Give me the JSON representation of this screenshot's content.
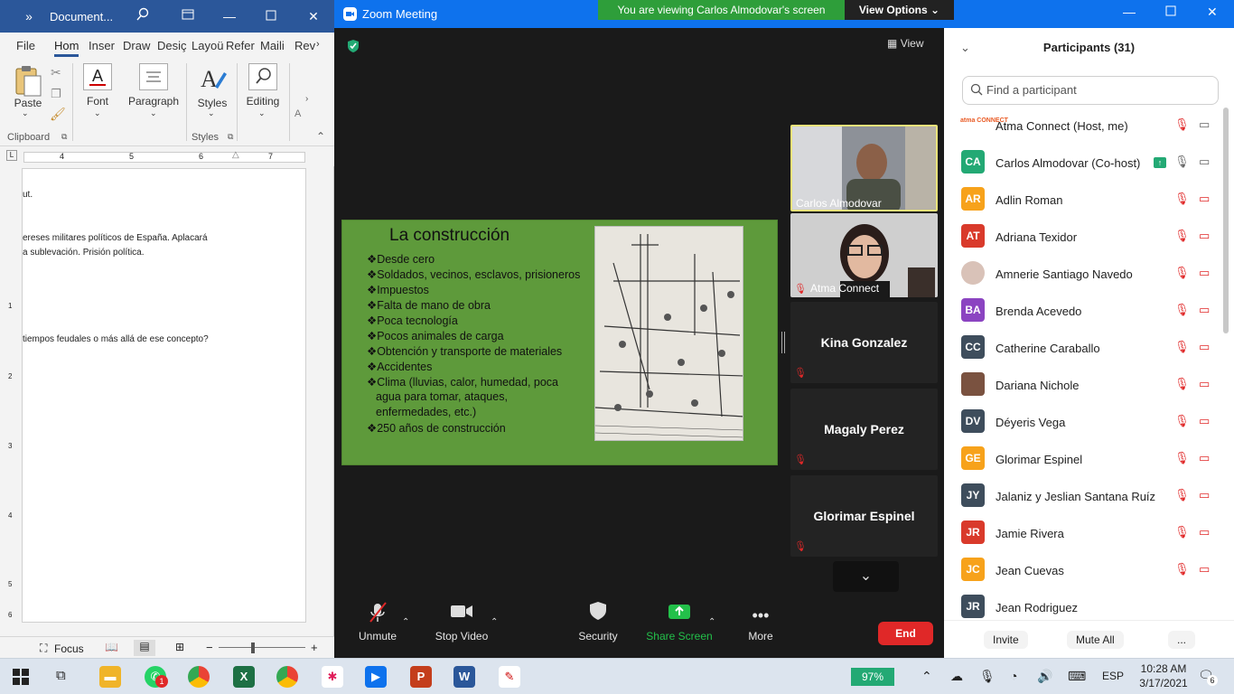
{
  "word": {
    "title": "Document...",
    "tabs": [
      "File",
      "Hom",
      "Inser",
      "Draw",
      "Desiç",
      "Layoü",
      "Refer",
      "Maili",
      "Rev"
    ],
    "ribbon": {
      "paste": "Paste",
      "font": "Font",
      "paragraph": "Paragraph",
      "styles": "Styles",
      "editing": "Editing",
      "clipboard_group": "Clipboard",
      "styles_group": "Styles"
    },
    "ruler_numbers": [
      "4",
      "5",
      "6",
      "7"
    ],
    "doc_lines": [
      "ut.",
      "ereses militares políticos de España. Aplacará",
      "a sublevación. Prisión política.",
      "tiempos feudales o más allá de ese concepto?"
    ],
    "vruler_numbers": [
      "1",
      "2",
      "3",
      "4",
      "5",
      "6"
    ],
    "status": {
      "focus": "Focus"
    }
  },
  "zoom": {
    "title": "Zoom Meeting",
    "banner": "You are viewing Carlos Almodovar's screen",
    "view_options": "View Options",
    "view_button": "View",
    "slide": {
      "title": "La construcción",
      "bullets": [
        "❖Desde cero",
        "❖Soldados, vecinos, esclavos, prisioneros",
        "❖Impuestos",
        "❖Falta de mano de obra",
        "❖Poca tecnología",
        "❖Pocos animales de carga",
        "❖Obtención y transporte de materiales",
        "❖Accidentes",
        "❖Clima (lluvias, calor, humedad, poca",
        "agua para tomar, ataques,",
        "enfermedades, etc.)",
        "❖250 años de construcción"
      ]
    },
    "tiles": [
      "Carlos Almodovar",
      "Atma Connect",
      "Kina Gonzalez",
      "Magaly Perez",
      "Glorimar Espinel"
    ],
    "controls": {
      "unmute": "Unmute",
      "stop_video": "Stop Video",
      "security": "Security",
      "share_screen": "Share Screen",
      "more": "More",
      "end": "End"
    },
    "participants": {
      "title": "Participants (31)",
      "search_placeholder": "Find a participant",
      "list": [
        {
          "initials": "",
          "name": "Atma Connect (Host, me)",
          "color": "#ffffff"
        },
        {
          "initials": "CA",
          "name": "Carlos Almodovar (Co-host)",
          "color": "#23a974"
        },
        {
          "initials": "AR",
          "name": "Adlin Roman",
          "color": "#f7a21b"
        },
        {
          "initials": "AT",
          "name": "Adriana Texidor",
          "color": "#d93a2b"
        },
        {
          "initials": "",
          "name": "Amnerie Santiago Navedo",
          "color": "#d9c2b8"
        },
        {
          "initials": "BA",
          "name": "Brenda Acevedo",
          "color": "#8b44c1"
        },
        {
          "initials": "CC",
          "name": "Catherine Caraballo",
          "color": "#3e4d5c"
        },
        {
          "initials": "",
          "name": "Dariana Nichole",
          "color": "#7a5240"
        },
        {
          "initials": "DV",
          "name": "Déyeris Vega",
          "color": "#3e4d5c"
        },
        {
          "initials": "GE",
          "name": "Glorimar Espinel",
          "color": "#f7a21b"
        },
        {
          "initials": "JY",
          "name": "Jalaniz y Jeslian Santana Ruíz",
          "color": "#3e4d5c"
        },
        {
          "initials": "JR",
          "name": "Jamie Rivera",
          "color": "#d93a2b"
        },
        {
          "initials": "JC",
          "name": "Jean Cuevas",
          "color": "#f7a21b"
        },
        {
          "initials": "JR",
          "name": "Jean Rodriguez",
          "color": "#3e4d5c"
        }
      ],
      "host_logo_text": "atma CONNECT",
      "invite": "Invite",
      "mute_all": "Mute All",
      "more": "..."
    }
  },
  "taskbar": {
    "battery": "97%",
    "lang": "ESP",
    "time": "10:28 AM",
    "date": "3/17/2021",
    "notif_count": "6",
    "whatsapp_badge": "1"
  },
  "colors": {
    "zoom_blue": "#0e72ed",
    "word_blue": "#2b579a",
    "end_red": "#e02828",
    "share_green": "#2e9e3a"
  }
}
